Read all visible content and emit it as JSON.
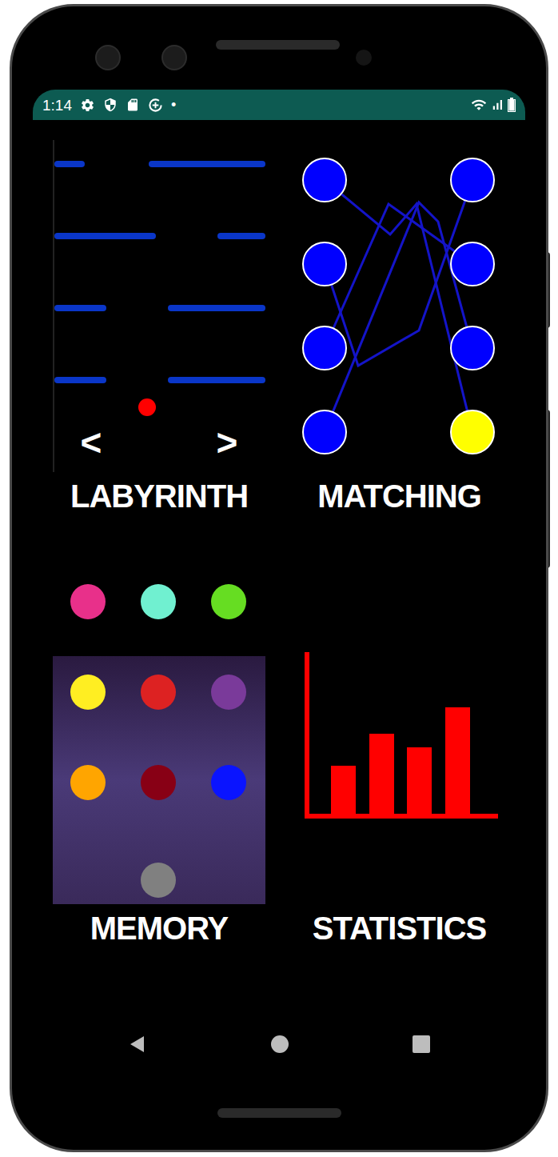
{
  "status_bar": {
    "time": "1:14",
    "dot": "•",
    "battery": {
      "level": 1
    }
  },
  "tiles": [
    {
      "kind": "labyrinth",
      "title": "LABYRINTH",
      "controls": [
        "<",
        ">"
      ]
    },
    {
      "kind": "matching",
      "title": "MATCHING",
      "left_nodes": [
        {
          "selected": false
        },
        {
          "selected": false
        },
        {
          "selected": false
        },
        {
          "selected": false
        }
      ],
      "right_nodes": [
        {
          "selected": false
        },
        {
          "selected": false
        },
        {
          "selected": false
        },
        {
          "selected": true
        }
      ]
    },
    {
      "kind": "memory",
      "title": "MEMORY",
      "dots": [
        {
          "color": "#e8308a"
        },
        {
          "color": "#70f0d0"
        },
        {
          "color": "#66dd22"
        },
        {
          "color": "#ffee22"
        },
        {
          "color": "#dd2222"
        },
        {
          "color": "#7a3a9a"
        },
        {
          "color": "#ffa500"
        },
        {
          "color": "#880015"
        },
        {
          "color": "#0a14ff"
        },
        {
          "color": "#808080"
        }
      ]
    },
    {
      "kind": "statistics",
      "title": "STATISTICS",
      "values": [
        60,
        100,
        83,
        133
      ]
    }
  ]
}
